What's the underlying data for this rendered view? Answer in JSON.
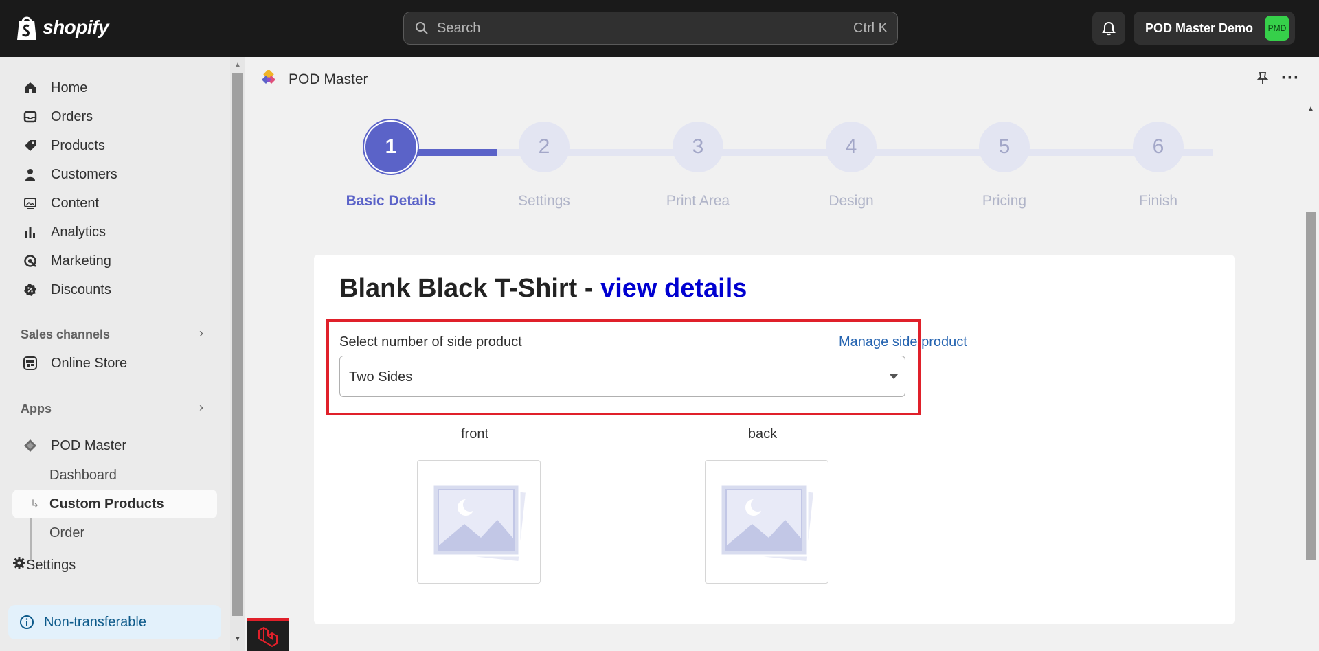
{
  "topbar": {
    "brand": "shopify",
    "search_placeholder": "Search",
    "search_shortcut": "Ctrl K",
    "store_name": "POD Master Demo",
    "store_initials": "PMD"
  },
  "sidebar": {
    "items": [
      {
        "label": "Home",
        "icon": "home-icon"
      },
      {
        "label": "Orders",
        "icon": "inbox-icon"
      },
      {
        "label": "Products",
        "icon": "tag-icon"
      },
      {
        "label": "Customers",
        "icon": "person-icon"
      },
      {
        "label": "Content",
        "icon": "image-icon"
      },
      {
        "label": "Analytics",
        "icon": "bar-chart-icon"
      },
      {
        "label": "Marketing",
        "icon": "target-icon"
      },
      {
        "label": "Discounts",
        "icon": "discount-icon"
      }
    ],
    "sales_channels": "Sales channels",
    "online_store": "Online Store",
    "apps": "Apps",
    "app_name": "POD Master",
    "app_subitems": [
      "Dashboard",
      "Custom Products",
      "Order"
    ],
    "settings": "Settings",
    "notice": "Non-transferable"
  },
  "app_header": {
    "title": "POD Master"
  },
  "stepper": {
    "steps": [
      {
        "number": "1",
        "label": "Basic Details"
      },
      {
        "number": "2",
        "label": "Settings"
      },
      {
        "number": "3",
        "label": "Print Area"
      },
      {
        "number": "4",
        "label": "Design"
      },
      {
        "number": "5",
        "label": "Pricing"
      },
      {
        "number": "6",
        "label": "Finish"
      }
    ],
    "active_index": 0
  },
  "card": {
    "title": "Blank Black T-Shirt - ",
    "title_link": "view details",
    "field_label": "Select number of side product",
    "manage_link": "Manage side product",
    "select_value": "Two Sides",
    "sides": [
      {
        "label": "front"
      },
      {
        "label": "back"
      }
    ]
  },
  "colors": {
    "accent": "#5b63c8",
    "highlight": "#e0202a",
    "link": "#0000d0",
    "topbar": "#1a1a1a"
  }
}
